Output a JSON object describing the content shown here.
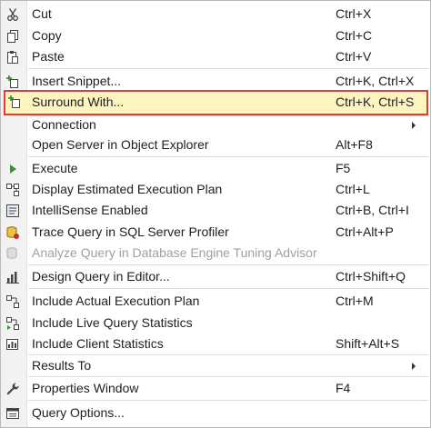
{
  "menu": {
    "items": [
      {
        "label": "Cut",
        "shortcut": "Ctrl+X",
        "icon": "scissors-icon"
      },
      {
        "label": "Copy",
        "shortcut": "Ctrl+C",
        "icon": "copy-icon"
      },
      {
        "label": "Paste",
        "shortcut": "Ctrl+V",
        "icon": "paste-icon"
      },
      {
        "label": "Insert Snippet...",
        "shortcut": "Ctrl+K, Ctrl+X",
        "icon": "insert-snippet-icon"
      },
      {
        "label": "Surround With...",
        "shortcut": "Ctrl+K, Ctrl+S",
        "icon": "surround-with-icon"
      },
      {
        "label": "Connection"
      },
      {
        "label": "Open Server in Object Explorer",
        "shortcut": "Alt+F8"
      },
      {
        "label": "Execute",
        "shortcut": "F5",
        "icon": "play-icon"
      },
      {
        "label": "Display Estimated Execution Plan",
        "shortcut": "Ctrl+L",
        "icon": "execution-plan-icon"
      },
      {
        "label": "IntelliSense Enabled",
        "shortcut": "Ctrl+B, Ctrl+I",
        "icon": "intellisense-icon"
      },
      {
        "label": "Trace Query in SQL Server Profiler",
        "shortcut": "Ctrl+Alt+P",
        "icon": "profiler-icon"
      },
      {
        "label": "Analyze Query in Database Engine Tuning Advisor",
        "icon": "tuning-advisor-icon"
      },
      {
        "label": "Design Query in Editor...",
        "shortcut": "Ctrl+Shift+Q",
        "icon": "design-query-icon"
      },
      {
        "label": "Include Actual Execution Plan",
        "shortcut": "Ctrl+M",
        "icon": "actual-plan-icon"
      },
      {
        "label": "Include Live Query Statistics",
        "icon": "live-stats-icon"
      },
      {
        "label": "Include Client Statistics",
        "shortcut": "Shift+Alt+S",
        "icon": "client-stats-icon"
      },
      {
        "label": "Results To"
      },
      {
        "label": "Properties Window",
        "shortcut": "F4",
        "icon": "wrench-icon"
      },
      {
        "label": "Query Options...",
        "icon": "query-options-icon"
      }
    ]
  },
  "colors": {
    "highlight_background": "#fdf4bf",
    "highlight_border": "#e03c3c",
    "gutter": "#f2f2f2",
    "disabled_text": "#a0a0a0"
  }
}
